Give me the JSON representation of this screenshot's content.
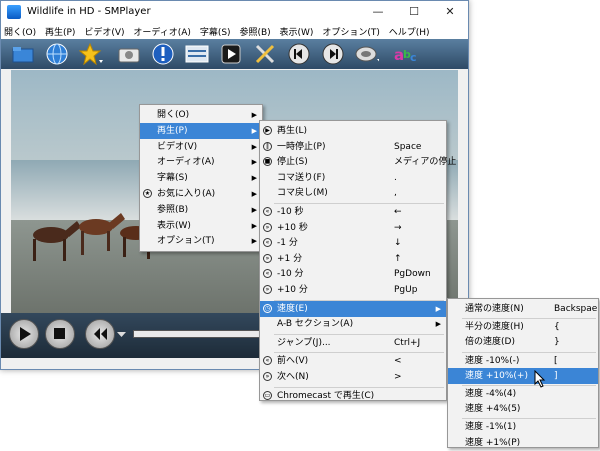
{
  "window": {
    "title": "Wildlife in HD - SMPlayer"
  },
  "window_controls": {
    "minimize": "—",
    "maximize": "☐",
    "close": "✕"
  },
  "menubar": [
    "開く(O)",
    "再生(P)",
    "ビデオ(V)",
    "オーディオ(A)",
    "字幕(S)",
    "参照(B)",
    "表示(W)",
    "オプション(T)",
    "ヘルプ(H)"
  ],
  "toolbar_icons": [
    "folder-icon",
    "globe-icon",
    "favorites-star-icon",
    "screenshot-camera-icon",
    "info-icon",
    "playlist-icon",
    "dvd-icon",
    "preferences-tools-icon",
    "previous-icon",
    "next-icon",
    "audio-track-icon",
    "subtitles-icon"
  ],
  "main_menu": [
    {
      "label": "開く(O)",
      "submenu": true
    },
    {
      "label": "再生(P)",
      "submenu": true,
      "highlighted": true
    },
    {
      "label": "ビデオ(V)",
      "submenu": true
    },
    {
      "label": "オーディオ(A)",
      "submenu": true
    },
    {
      "label": "字幕(S)",
      "submenu": true
    },
    {
      "label": "お気に入り(A)",
      "submenu": true
    },
    {
      "label": "参照(B)",
      "submenu": true
    },
    {
      "label": "表示(W)",
      "submenu": true
    },
    {
      "label": "オプション(T)",
      "submenu": true
    }
  ],
  "play_menu": [
    {
      "label": "再生(L)",
      "shortcut": ""
    },
    {
      "label": "一時停止(P)",
      "shortcut": "Space"
    },
    {
      "label": "停止(S)",
      "shortcut": "メディアの停止"
    },
    {
      "label": "コマ送り(F)",
      "shortcut": "."
    },
    {
      "label": "コマ戻し(M)",
      "shortcut": ","
    },
    {
      "label": "-10 秒",
      "shortcut": "←"
    },
    {
      "label": "+10 秒",
      "shortcut": "→"
    },
    {
      "label": "-1 分",
      "shortcut": "↓"
    },
    {
      "label": "+1 分",
      "shortcut": "↑"
    },
    {
      "label": "-10 分",
      "shortcut": "PgDown"
    },
    {
      "label": "+10 分",
      "shortcut": "PgUp"
    },
    {
      "label": "速度(E)",
      "shortcut": "",
      "submenu": true,
      "highlighted": true
    },
    {
      "label": "A-B セクション(A)",
      "shortcut": "",
      "submenu": true
    },
    {
      "label": "ジャンプ(J)...",
      "shortcut": "Ctrl+J"
    },
    {
      "label": "前へ(V)",
      "shortcut": "<"
    },
    {
      "label": "次へ(N)",
      "shortcut": ">"
    },
    {
      "label": "Chromecast で再生(C)",
      "shortcut": ""
    }
  ],
  "speed_menu": [
    {
      "label": "通常の速度(N)",
      "shortcut": "Backspae"
    },
    {
      "label": "半分の速度(H)",
      "shortcut": "{"
    },
    {
      "label": "倍の速度(D)",
      "shortcut": "}"
    },
    {
      "label": "速度 -10%(-)",
      "shortcut": "["
    },
    {
      "label": "速度 +10%(+)",
      "shortcut": "]",
      "highlighted": true
    },
    {
      "label": "速度 -4%(4)",
      "shortcut": ""
    },
    {
      "label": "速度 +4%(5)",
      "shortcut": ""
    },
    {
      "label": "速度 -1%(1)",
      "shortcut": ""
    },
    {
      "label": "速度 +1%(P)",
      "shortcut": ""
    }
  ],
  "colors": {
    "highlight": "#3b85d6",
    "toolbar": "#3d5e7c",
    "menu_bg": "#f2f2f2"
  }
}
